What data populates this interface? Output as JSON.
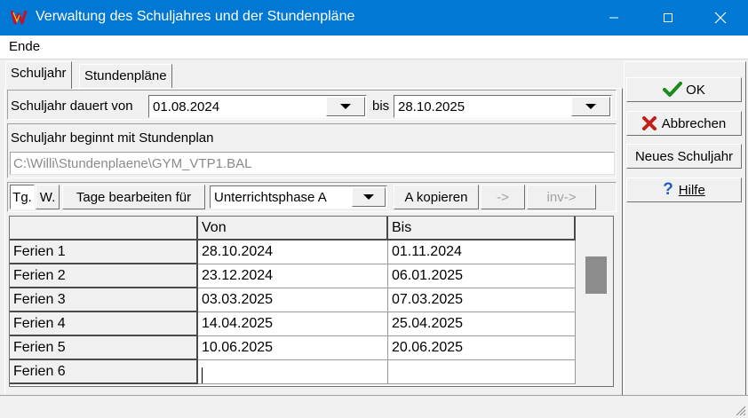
{
  "window": {
    "title": "Verwaltung des Schuljahres und der Stundenpläne"
  },
  "menu": {
    "items": [
      "Ende"
    ]
  },
  "tabs": [
    {
      "label": "Schuljahr",
      "active": true
    },
    {
      "label": "Stundenpläne",
      "active": false
    }
  ],
  "schuljahr": {
    "dauert_label": "Schuljahr dauert von",
    "from_date": "01.08.2024",
    "bis_label": "bis",
    "to_date": "28.10.2025",
    "beginnt_label": "Schuljahr beginnt mit Stundenplan",
    "plan_path": "C:\\Willi\\Stundenplaene\\GYM_VTP1.BAL"
  },
  "toolbar": {
    "tg": "Tg.",
    "w": "W.",
    "tage_bearbeiten": "Tage bearbeiten für",
    "phase": "Unterrichtsphase A",
    "a_kopieren": "A kopieren",
    "arrow": "->",
    "inv_arrow": "inv->"
  },
  "grid": {
    "headers": [
      "",
      "Von",
      "Bis"
    ],
    "rows": [
      {
        "label": "Ferien 1",
        "von": "28.10.2024",
        "bis": "01.11.2024"
      },
      {
        "label": "Ferien 2",
        "von": "23.12.2024",
        "bis": "06.01.2025"
      },
      {
        "label": "Ferien 3",
        "von": "03.03.2025",
        "bis": "07.03.2025"
      },
      {
        "label": "Ferien 4",
        "von": "14.04.2025",
        "bis": "25.04.2025"
      },
      {
        "label": "Ferien 5",
        "von": "10.06.2025",
        "bis": "20.06.2025"
      },
      {
        "label": "Ferien 6",
        "von": "",
        "bis": ""
      }
    ]
  },
  "sidebar": {
    "ok": "OK",
    "abbrechen": "Abbrechen",
    "neues_schuljahr": "Neues Schuljahr",
    "hilfe": "Hilfe"
  },
  "colors": {
    "titlebar": "#0078d4",
    "face": "#f0f0f0",
    "ok_check": "#1a8a1a",
    "cancel_x": "#c0201a",
    "help_q": "#1f5fc4"
  }
}
